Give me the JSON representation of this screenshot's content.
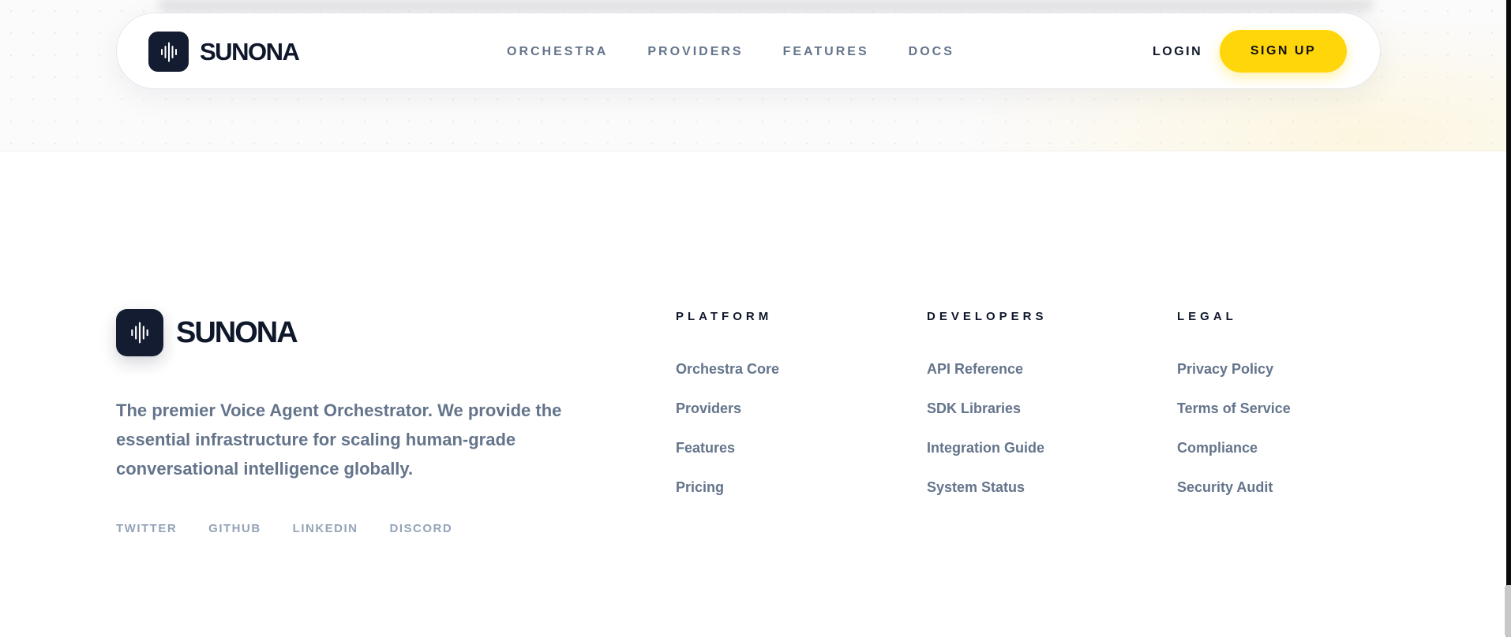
{
  "brand": {
    "name": "SUNONA",
    "logo_icon": "waveform-icon",
    "colors": {
      "primary": "#131c30",
      "accent": "#ffd60a"
    }
  },
  "navbar": {
    "links": [
      "ORCHESTRA",
      "PROVIDERS",
      "FEATURES",
      "DOCS"
    ],
    "login_label": "LOGIN",
    "signup_label": "SIGN UP"
  },
  "footer": {
    "tagline": "The premier Voice Agent Orchestrator. We provide the essential infrastructure for scaling human-grade conversational intelligence globally.",
    "socials": [
      "TWITTER",
      "GITHUB",
      "LINKEDIN",
      "DISCORD"
    ],
    "columns": [
      {
        "heading": "PLATFORM",
        "links": [
          "Orchestra Core",
          "Providers",
          "Features",
          "Pricing"
        ]
      },
      {
        "heading": "DEVELOPERS",
        "links": [
          "API Reference",
          "SDK Libraries",
          "Integration Guide",
          "System Status"
        ]
      },
      {
        "heading": "LEGAL",
        "links": [
          "Privacy Policy",
          "Terms of Service",
          "Compliance",
          "Security Audit"
        ]
      }
    ]
  }
}
